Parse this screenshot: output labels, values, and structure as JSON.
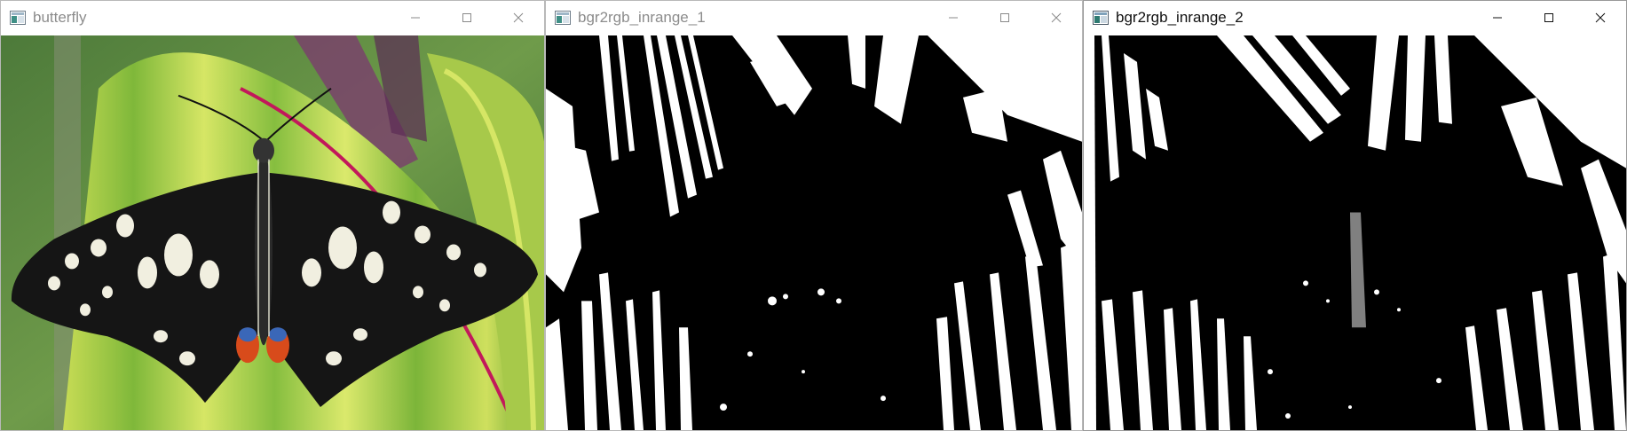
{
  "windows": [
    {
      "title": "butterfly",
      "state": "inactive",
      "image": "color photo of a black-and-white swallowtail butterfly on a green-and-yellow striped leaf"
    },
    {
      "title": "bgr2rgb_inrange_1",
      "state": "inactive",
      "image": "binary black-and-white mask of the butterfly photo"
    },
    {
      "title": "bgr2rgb_inrange_2",
      "state": "active",
      "image": "binary black-and-white mask of the butterfly photo, noisier variant"
    }
  ],
  "controls": {
    "minimize_icon": "minimize-icon",
    "maximize_icon": "maximize-icon",
    "close_icon": "close-icon"
  },
  "colors": {
    "leaf_green": "#8cc63f",
    "leaf_yellow": "#d9e86a",
    "leaf_edge": "#c2185b",
    "wing_black": "#151515",
    "spot_cream": "#f1efe0",
    "eyespot_red": "#d84b1b",
    "eyespot_blue": "#3a67b8"
  }
}
